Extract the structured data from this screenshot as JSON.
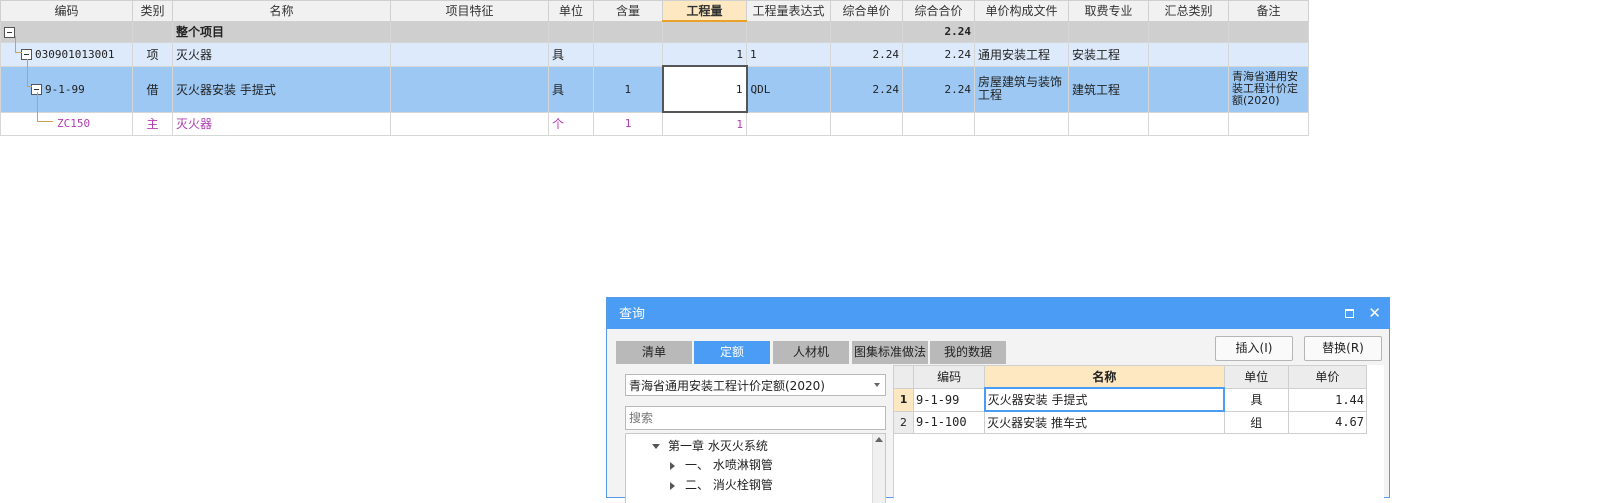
{
  "grid": {
    "headers": [
      "编码",
      "类别",
      "名称",
      "项目特征",
      "单位",
      "含量",
      "工程量",
      "工程量表达式",
      "综合单价",
      "综合合价",
      "单价构成文件",
      "取费专业",
      "汇总类别",
      "备注"
    ],
    "whole": {
      "label": "整个项目",
      "total": "2.24"
    },
    "qd": {
      "code": "030901013001",
      "type": "项",
      "name": "灭火器",
      "feature": "",
      "unit": "具",
      "content": "",
      "qty": "1",
      "expr": "1",
      "unit_price": "2.24",
      "total": "2.24",
      "file": "通用安装工程",
      "fee": "安装工程",
      "sum": "",
      "note": ""
    },
    "de": {
      "code": "9-1-99",
      "type": "借",
      "name": "灭火器安装 手提式",
      "feature": "",
      "unit": "具",
      "content": "1",
      "qty": "1",
      "expr": "QDL",
      "unit_price": "2.24",
      "total": "2.24",
      "file": "房屋建筑与装饰工程",
      "fee": "建筑工程",
      "sum": "",
      "note": "青海省通用安装工程计价定额(2020)"
    },
    "zc": {
      "code": "ZC150",
      "type": "主",
      "name": "灭火器",
      "feature": "",
      "unit": "个",
      "content": "1",
      "qty": "1",
      "expr": "",
      "unit_price": "",
      "total": "",
      "file": "",
      "fee": "",
      "sum": "",
      "note": ""
    }
  },
  "dialog": {
    "title": "查询",
    "tabs": [
      "清单",
      "定额",
      "人材机",
      "图集标准做法",
      "我的数据"
    ],
    "selected_tab": "定额",
    "insert_label": "插入(I)",
    "replace_label": "替换(R)",
    "library": "青海省通用安装工程计价定额(2020)",
    "search_placeholder": "搜索",
    "tree": [
      {
        "label": "第一章  水灭火系统"
      },
      {
        "label": "一、  水喷淋钢管"
      },
      {
        "label": "二、  消火栓钢管"
      }
    ],
    "results": {
      "headers": [
        "编码",
        "名称",
        "单位",
        "单价"
      ],
      "rows": [
        {
          "idx": "1",
          "code": "9-1-99",
          "name": "灭火器安装 手提式",
          "unit": "具",
          "price": "1.44"
        },
        {
          "idx": "2",
          "code": "9-1-100",
          "name": "灭火器安装 推车式",
          "unit": "组",
          "price": "4.67"
        }
      ]
    }
  },
  "colors": {
    "accent": "#4a9cf5",
    "selected_row": "#9cc8f3",
    "qd_row": "#ddeafb",
    "whole_row": "#cfcfcf",
    "material_text": "#b23bb4",
    "header_active": "#fde8c2"
  }
}
